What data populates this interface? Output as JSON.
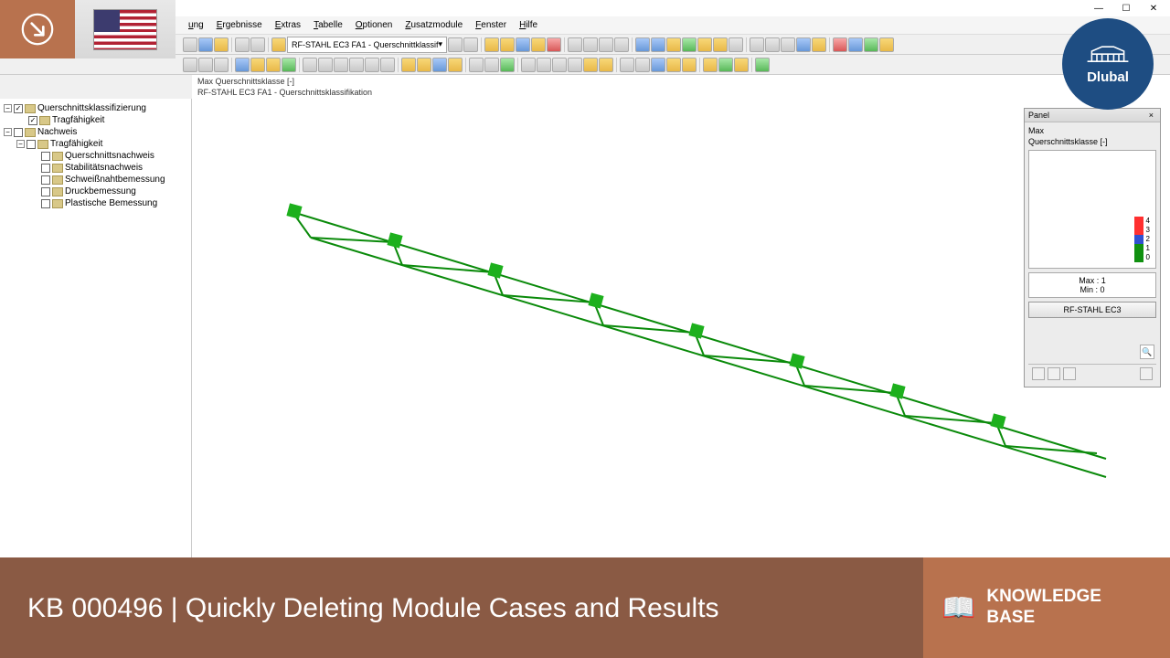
{
  "overlay": {
    "logo_text": "Dlubal"
  },
  "banner": {
    "title": "KB 000496 | Quickly Deleting Module Cases and Results",
    "icon": "📖",
    "label": "KNOWLEDGE BASE"
  },
  "window": {
    "min": "—",
    "max": "☐",
    "close": "✕"
  },
  "menu": {
    "items": [
      "ung",
      "Ergebnisse",
      "Extras",
      "Tabelle",
      "Optionen",
      "Zusatzmodule",
      "Fenster",
      "Hilfe"
    ]
  },
  "toolbar": {
    "combo": "RF-STAHL EC3 FA1 - Querschnittklassif",
    "arrow": "▾"
  },
  "tree": {
    "items": [
      {
        "depth": 0,
        "toggle": "−",
        "check": "✓",
        "label": "Querschnittsklassifizierung"
      },
      {
        "depth": 1,
        "toggle": "",
        "check": "✓",
        "label": "Tragfähigkeit"
      },
      {
        "depth": 0,
        "toggle": "−",
        "check": "",
        "label": "Nachweis"
      },
      {
        "depth": 1,
        "toggle": "−",
        "check": "",
        "label": "Tragfähigkeit"
      },
      {
        "depth": 2,
        "toggle": "",
        "check": "",
        "label": "Querschnittsnachweis"
      },
      {
        "depth": 2,
        "toggle": "",
        "check": "",
        "label": "Stabilitätsnachweis"
      },
      {
        "depth": 2,
        "toggle": "",
        "check": "",
        "label": "Schweißnahtbemessung"
      },
      {
        "depth": 2,
        "toggle": "",
        "check": "",
        "label": "Druckbemessung"
      },
      {
        "depth": 2,
        "toggle": "",
        "check": "",
        "label": "Plastische Bemessung"
      }
    ]
  },
  "viewport": {
    "line1": "Max Querschnittsklasse [-]",
    "line2": "RF-STAHL EC3 FA1 - Querschnittsklassifikation"
  },
  "panel": {
    "title": "Panel",
    "close": "×",
    "sub1": "Max",
    "sub2": "Querschnittsklasse [-]",
    "legend": [
      "4",
      "3",
      "2",
      "1",
      "0"
    ],
    "legend_colors": [
      "#ff3030",
      "#ff3030",
      "#3050d0",
      "#109010",
      "#109010"
    ],
    "max_label": "Max :",
    "max_val": "1",
    "min_label": "Min :",
    "min_val": "0",
    "button": "RF-STAHL EC3",
    "zoom": "🔍"
  }
}
